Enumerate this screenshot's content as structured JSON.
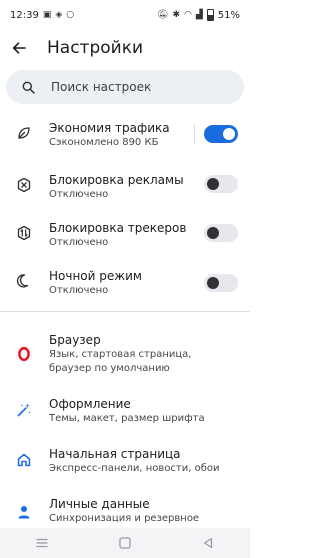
{
  "status_bar": {
    "time": "12:39",
    "battery": "51%"
  },
  "header": {
    "title": "Настройки"
  },
  "search": {
    "placeholder": "Поиск настроек"
  },
  "toggle_items": [
    {
      "title": "Экономия трафика",
      "subtitle": "Сэкономлено 890 КБ",
      "enabled": true,
      "icon": "leaf-icon"
    },
    {
      "title": "Блокировка рекламы",
      "subtitle": "Отключено",
      "enabled": false,
      "icon": "ad-block-icon"
    },
    {
      "title": "Блокировка трекеров",
      "subtitle": "Отключено",
      "enabled": false,
      "icon": "tracker-block-icon"
    },
    {
      "title": "Ночной режим",
      "subtitle": "Отключено",
      "enabled": false,
      "icon": "moon-icon"
    }
  ],
  "nav_items": [
    {
      "title": "Браузер",
      "subtitle": "Язык, стартовая страница, браузер по умолчанию",
      "icon": "opera-icon"
    },
    {
      "title": "Оформление",
      "subtitle": "Темы, макет, размер шрифта",
      "icon": "magic-wand-icon"
    },
    {
      "title": "Начальная страница",
      "subtitle": "Экспресс-панели, новости, обои",
      "icon": "home-icon"
    },
    {
      "title": "Личные данные",
      "subtitle": "Синхронизация и резервное",
      "icon": "person-icon"
    }
  ],
  "colors": {
    "accent": "#1a6ce0",
    "opera_red": "#e0101e",
    "search_bg": "#eceff4"
  }
}
